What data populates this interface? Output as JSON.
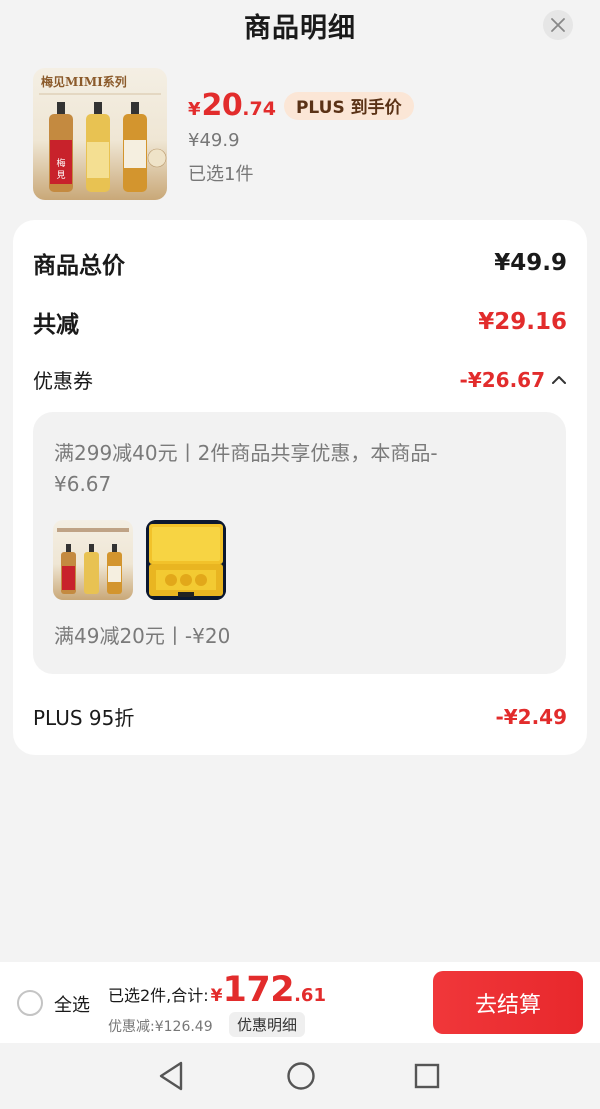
{
  "header": {
    "title": "商品明细"
  },
  "product": {
    "image_caption": "梅见MIMI系列",
    "price_symbol": "¥",
    "price_int": "20",
    "price_dec": ".74",
    "plus_tag": "PLUS 到手价",
    "original_price": "¥49.9",
    "selected_count": "已选1件"
  },
  "details": {
    "total_label": "商品总价",
    "total_value": "¥49.9",
    "reduce_label": "共减",
    "reduce_value": "¥29.16",
    "coupon_label": "优惠券",
    "coupon_value": "-¥26.67",
    "coupon_desc_1": "满299减40元丨2件商品共享优惠，本商品-¥6.67",
    "coupon_desc_2": "满49减20元丨-¥20",
    "plus_label": "PLUS 95折",
    "plus_value": "-¥2.49"
  },
  "bottom": {
    "select_all": "全选",
    "total_label": "已选2件,合计:",
    "total_symbol": "¥",
    "total_int": "172",
    "total_dec": ".61",
    "discount": "优惠减:¥126.49",
    "detail_link": "优惠明细",
    "checkout": "去结算"
  },
  "colors": {
    "accent": "#e22c2c",
    "plus_tag_bg": "#fbe6d6"
  },
  "icons": [
    "close-icon",
    "chevron-up-icon",
    "back-nav-icon",
    "home-nav-icon",
    "recents-nav-icon"
  ]
}
